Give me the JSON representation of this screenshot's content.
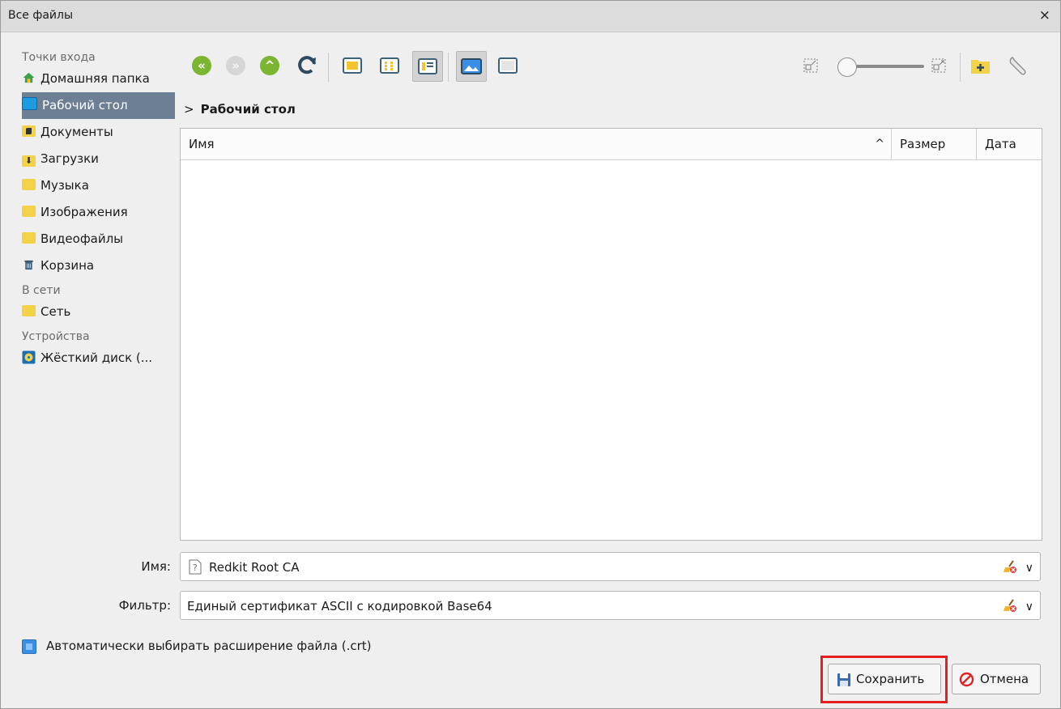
{
  "window": {
    "title": "Все файлы",
    "close_glyph": "×"
  },
  "sidebar": {
    "sections": [
      {
        "title": "Точки входа",
        "items": [
          {
            "label": "Домашняя папка",
            "icon": "home-icon"
          },
          {
            "label": "Рабочий стол",
            "icon": "desktop-icon",
            "selected": true
          },
          {
            "label": "Документы",
            "icon": "documents-folder-icon"
          },
          {
            "label": "Загрузки",
            "icon": "downloads-folder-icon"
          },
          {
            "label": "Музыка",
            "icon": "folder-icon"
          },
          {
            "label": "Изображения",
            "icon": "folder-icon"
          },
          {
            "label": "Видеофайлы",
            "icon": "folder-icon"
          },
          {
            "label": "Корзина",
            "icon": "trash-icon"
          }
        ]
      },
      {
        "title": "В сети",
        "items": [
          {
            "label": "Сеть",
            "icon": "folder-icon"
          }
        ]
      },
      {
        "title": "Устройства",
        "items": [
          {
            "label": "Жёсткий диск (...",
            "icon": "hard-disk-icon"
          }
        ]
      }
    ]
  },
  "toolbar": {
    "icons": [
      "back-icon",
      "forward-icon",
      "up-icon",
      "reload-icon",
      "icon-view-icon",
      "compact-view-icon",
      "detailed-view-icon",
      "preview-icon",
      "panel-icon",
      "zoom-out-icon",
      "zoom-in-icon",
      "new-folder-icon",
      "settings-icon"
    ],
    "zoom_level": 0
  },
  "breadcrumb": {
    "chevron": ">",
    "current": "Рабочий стол"
  },
  "filelist": {
    "columns": [
      {
        "label": "Имя",
        "sorted": "asc"
      },
      {
        "label": "Размер"
      },
      {
        "label": "Дата"
      }
    ],
    "sort_glyph": "^",
    "rows": []
  },
  "form": {
    "name_label": "Имя:",
    "name_value": "Redkit Root CA",
    "name_icon": "unknown-file-icon",
    "filter_label": "Фильтр:",
    "filter_value": "Единый сертификат ASCII с кодировкой Base64",
    "dropdown_glyph": "∨"
  },
  "auto_extension": {
    "label": "Автоматически выбирать расширение файла (.crt)",
    "checked": true
  },
  "buttons": {
    "save": "Сохранить",
    "cancel": "Отмена"
  },
  "colors": {
    "selection": "#6d7f95",
    "nav_green": "#7cb531",
    "highlight": "#e51f1f",
    "checkbox": "#3b8ee5"
  }
}
